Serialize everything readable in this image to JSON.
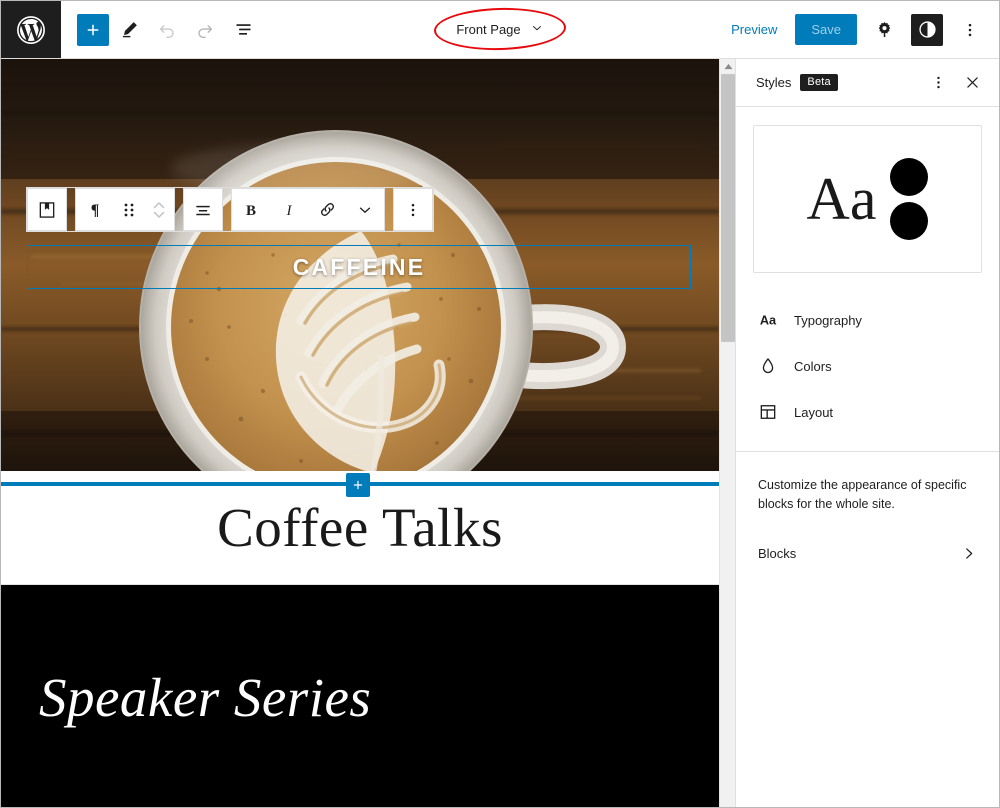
{
  "topbar": {
    "logo_icon": "wordpress-logo-icon",
    "add_block_label": "+",
    "add_block_icon": "plus-icon",
    "edit_icon": "pencil-edit-icon",
    "undo_icon": "undo-arrow-icon",
    "redo_icon": "redo-arrow-icon",
    "list_view_icon": "list-view-icon",
    "document_title": "Front Page",
    "document_title_chevron_icon": "chevron-down-icon",
    "preview_label": "Preview",
    "save_label": "Save",
    "settings_icon": "gear-settings-icon",
    "styles_icon": "styles-contrast-icon",
    "options_icon": "three-dots-vertical-icon"
  },
  "annotation": {
    "shape": "red-ellipse-highlight",
    "color": "#e8090c",
    "targets": "Front Page"
  },
  "block_toolbar": {
    "block_type_icon": "cover-block-icon",
    "paragraph_icon": "paragraph-pilcrow-icon",
    "drag_icon": "drag-handle-dots-icon",
    "move_updown_icon": "move-up-down-arrows-icon",
    "align_icon": "align-text-icon",
    "bold_label": "B",
    "italic_label": "I",
    "link_icon": "link-icon",
    "more_formats_icon": "chevron-down-icon",
    "block_options_icon": "three-dots-vertical-icon"
  },
  "canvas": {
    "cover_text": "CAFFEINE",
    "cover_image": "coffee-latte-cup-on-wooden-table",
    "heading_text": "Coffee Talks",
    "inserter_icon": "plus-icon",
    "black_section_text": "Speaker Series",
    "selection_color": "#007cba"
  },
  "scrollbar": {
    "up_arrow_icon": "scroll-up-arrow-icon",
    "thumb": "vertical-scroll-thumb"
  },
  "sidebar": {
    "title": "Styles",
    "badge": "Beta",
    "more_icon": "three-dots-vertical-icon",
    "close_icon": "close-x-icon",
    "preview": {
      "sample_text": "Aa",
      "palette_dot_1": "#000000",
      "palette_dot_2": "#000000"
    },
    "menu": [
      {
        "label": "Typography",
        "icon": "typography-aa-icon"
      },
      {
        "label": "Colors",
        "icon": "color-droplet-icon"
      },
      {
        "label": "Layout",
        "icon": "layout-grid-icon"
      }
    ],
    "blocks_description": "Customize the appearance of specific blocks for the whole site.",
    "blocks_label": "Blocks",
    "blocks_chevron_icon": "chevron-right-icon"
  }
}
